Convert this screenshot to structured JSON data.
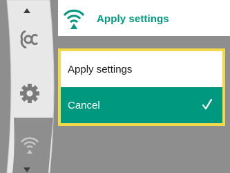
{
  "header": {
    "title": "Apply settings",
    "icon": "wireless-apply-icon"
  },
  "menu": {
    "icons": [
      "settings-transfer-icon",
      "gear-icon",
      "wireless-apply-icon"
    ],
    "selected": "wireless-apply-icon"
  },
  "dialog": {
    "options": [
      {
        "label": "Apply settings",
        "selected": false
      },
      {
        "label": "Cancel",
        "selected": true,
        "icon": "checkmark-icon"
      }
    ]
  },
  "colors": {
    "accent": "#00997f",
    "highlight_border": "#f2d94a",
    "background": "#8e8e8e",
    "menu_bg": "#e8e8e8",
    "menu_selected_bg": "#8e8e8e"
  }
}
